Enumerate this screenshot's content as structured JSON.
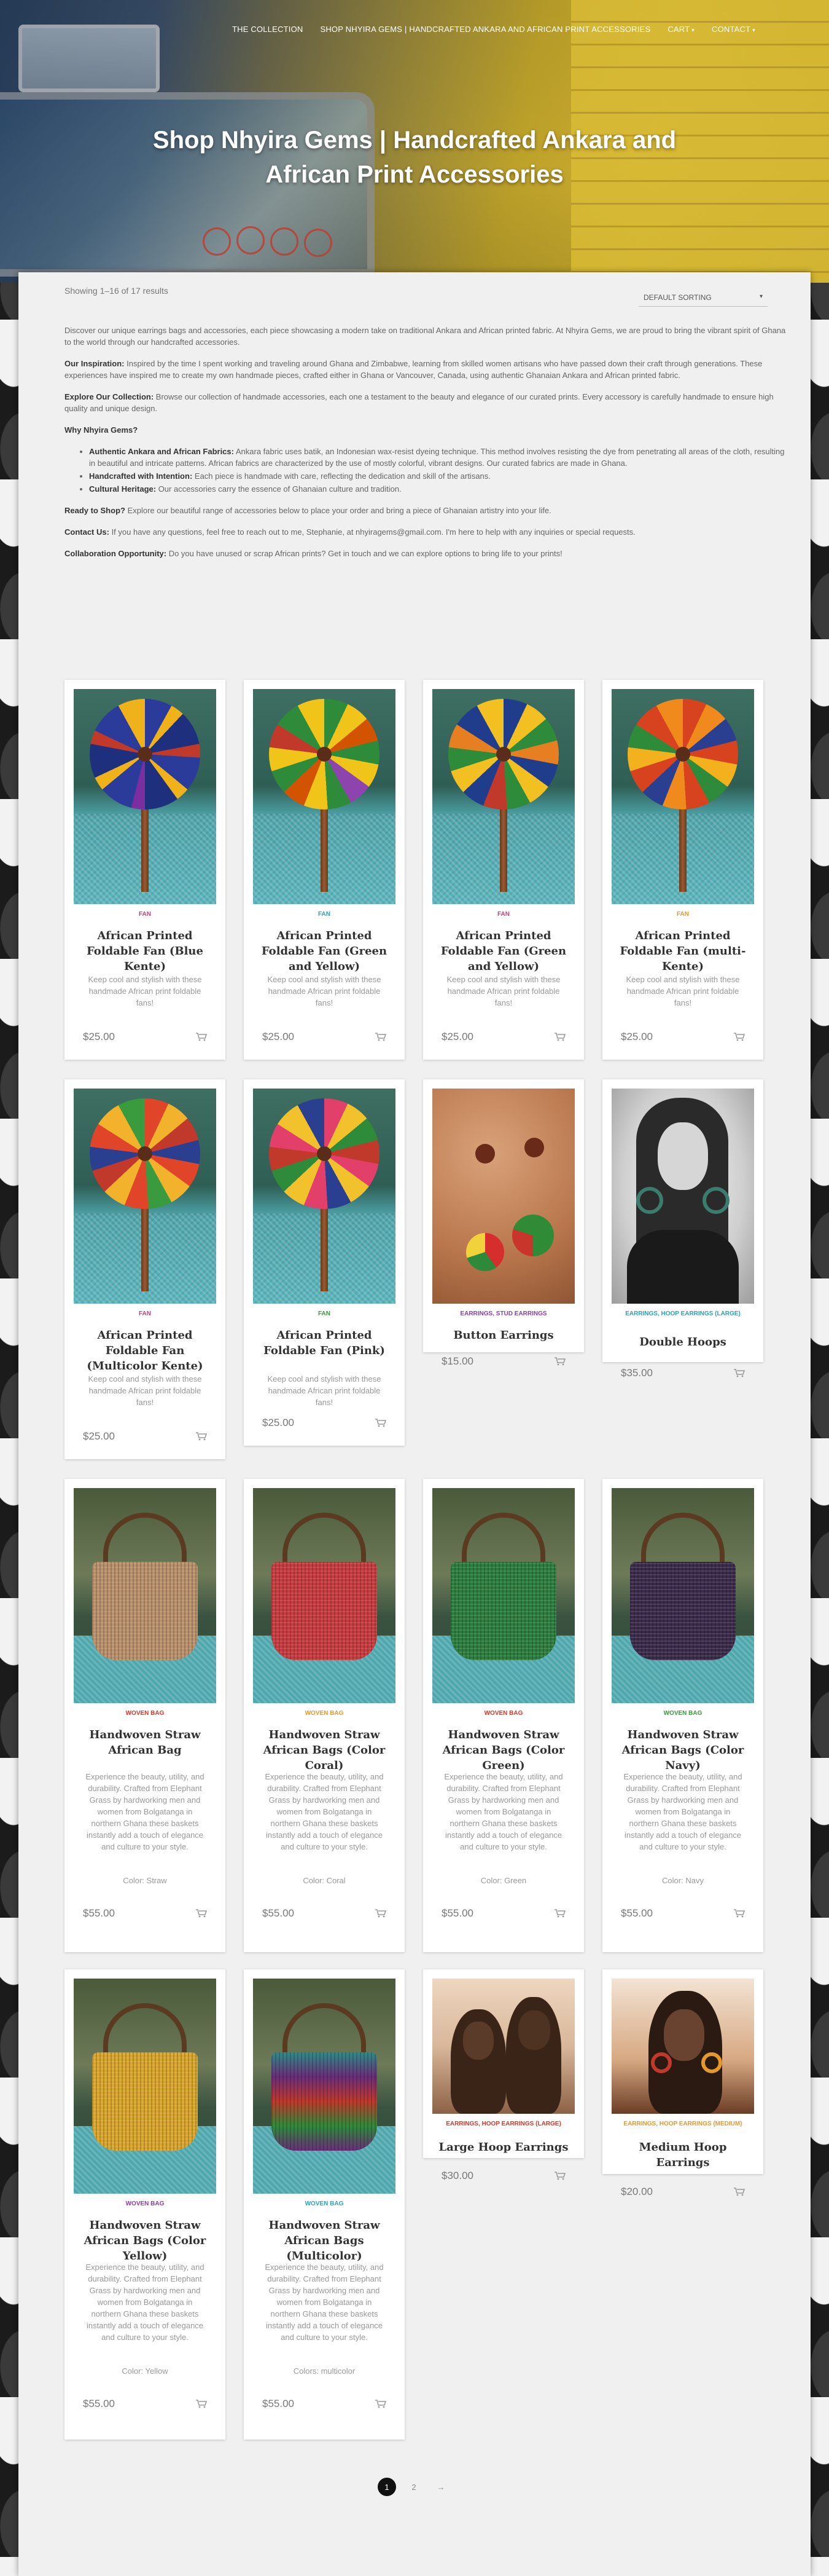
{
  "nav": {
    "items": [
      {
        "label": "THE COLLECTION"
      },
      {
        "label": "SHOP NHYIRA GEMS | HANDCRAFTED ANKARA AND AFRICAN PRINT ACCESSORIES"
      },
      {
        "label": "CART"
      },
      {
        "label": "CONTACT"
      }
    ]
  },
  "hero": {
    "title_line1": "Shop Nhyira Gems | Handcrafted Ankara and",
    "title_line2": "African Print Accessories"
  },
  "shop": {
    "result_count": "Showing 1–16 of 17 results",
    "ordering": "DEFAULT SORTING"
  },
  "description": {
    "intro": "Discover our unique earrings bags and accessories, each piece showcasing a modern take on traditional Ankara and African printed fabric. At Nhyira Gems, we are proud to bring the vibrant spirit of Ghana to the world through our handcrafted accessories.",
    "inspiration_label": "Our Inspiration:",
    "inspiration_text": " Inspired by the time I spent working and traveling around Ghana and Zimbabwe, learning from skilled women artisans who have passed down their craft through generations. These experiences have inspired me to create my own handmade pieces, crafted either in Ghana or Vancouver, Canada, using authentic Ghanaian Ankara and African printed fabric.",
    "collection_label": "Explore Our Collection:",
    "collection_text": " Browse our collection of handmade accessories, each one a testament to the beauty and elegance of our curated prints. Every accessory is carefully handmade to ensure high quality and unique design.",
    "why_label": "Why Nhyira Gems?",
    "bullets": [
      {
        "label": "Authentic Ankara and African Fabrics:",
        "text": " Ankara fabric uses batik, an Indonesian wax-resist dyeing technique. This method involves resisting the dye from penetrating all areas of the cloth, resulting in beautiful and intricate patterns. African fabrics are characterized by the use of mostly colorful, vibrant designs. Our curated fabrics are made in Ghana."
      },
      {
        "label": "Handcrafted with Intention:",
        "text": " Each piece is handmade with care, reflecting the dedication and skill of the artisans."
      },
      {
        "label": "Cultural Heritage:",
        "text": " Our accessories carry the essence of Ghanaian culture and tradition."
      }
    ],
    "ready_label": "Ready to Shop?",
    "ready_text": " Explore our beautiful range of accessories below to place your order and bring a piece of Ghanaian artistry into your life.",
    "contact_label": "Contact Us:",
    "contact_text": " If you have any questions, feel free to reach out to me, Stephanie, at nhyiragems@gmail.com. I'm here to help with any inquiries or special requests.",
    "collab_label": "Collaboration Opportunity:",
    "collab_text": " Do you have unused or scrap African prints? Get in touch and we can explore options to bring life to your prints!"
  },
  "products": [
    {
      "category": "FAN",
      "name": "African Printed Foldable Fan (Blue Kente)",
      "desc": "Keep cool and stylish with these handmade African print foldable fans!",
      "price": "$25.00",
      "cat_color": "#c2417f"
    },
    {
      "category": "FAN",
      "name": "African Printed Foldable Fan (Green and Yellow)",
      "desc": "Keep cool and stylish with these handmade African print foldable fans!",
      "price": "$25.00",
      "cat_color": "#2aa3b9"
    },
    {
      "category": "FAN",
      "name": "African Printed Foldable Fan (Green and Yellow)",
      "desc": "Keep cool and stylish with these handmade African print foldable fans!",
      "price": "$25.00",
      "cat_color": "#c2417f"
    },
    {
      "category": "FAN",
      "name": "African Printed Foldable Fan (multi-Kente)",
      "desc": "Keep cool and stylish with these handmade African print foldable fans!",
      "price": "$25.00",
      "cat_color": "#e39a2b"
    },
    {
      "category": "FAN",
      "name": "African Printed Foldable Fan (Multicolor Kente)",
      "desc": "Keep cool and stylish with these handmade African print foldable fans!",
      "price": "$25.00",
      "cat_color": "#c2417f"
    },
    {
      "category": "FAN",
      "name": "African Printed Foldable Fan (Pink)",
      "desc": "Keep cool and stylish with these handmade African print foldable fans!",
      "price": "$25.00",
      "cat_color": "#3a9a3e"
    },
    {
      "category": "EARRINGS, STUD EARRINGS",
      "name": "Button Earrings",
      "desc": "",
      "price": "$15.00",
      "cat_color": "#8a3fa8"
    },
    {
      "category": "EARRINGS, HOOP EARRINGS (LARGE)",
      "name": "Double Hoops",
      "desc": "",
      "price": "$35.00",
      "cat_color": "#2aa3b9"
    },
    {
      "category": "WOVEN BAG",
      "name": "Handwoven Straw African Bag",
      "desc": "Experience the beauty, utility, and durability. Crafted from Elephant Grass by hardworking men and women from Bolgatanga in northern Ghana these baskets instantly add a touch of elegance and culture to your style.",
      "color": "Color: Straw",
      "price": "$55.00",
      "cat_color": "#d33a2c"
    },
    {
      "category": "WOVEN BAG",
      "name": "Handwoven Straw African Bags (Color Coral)",
      "desc": "Experience the beauty, utility, and durability. Crafted from Elephant Grass by hardworking men and women from Bolgatanga in northern Ghana these baskets instantly add a touch of elegance and culture to your style.",
      "color": "Color: Coral",
      "price": "$55.00",
      "cat_color": "#e39a2b"
    },
    {
      "category": "WOVEN BAG",
      "name": "Handwoven Straw African Bags (Color Green)",
      "desc": "Experience the beauty, utility, and durability. Crafted from Elephant Grass by hardworking men and women from Bolgatanga in northern Ghana these baskets instantly add a touch of elegance and culture to your style.",
      "color": "Color: Green",
      "price": "$55.00",
      "cat_color": "#d33a2c"
    },
    {
      "category": "WOVEN BAG",
      "name": "Handwoven Straw African Bags (Color Navy)",
      "desc": "Experience the beauty, utility, and durability. Crafted from Elephant Grass by hardworking men and women from Bolgatanga in northern Ghana these baskets instantly add a touch of elegance and culture to your style.",
      "color": "Color: Navy",
      "price": "$55.00",
      "cat_color": "#3a9a3e"
    },
    {
      "category": "WOVEN BAG",
      "name": "Handwoven Straw African Bags (Color Yellow)",
      "desc": "Experience the beauty, utility, and durability. Crafted from Elephant Grass by hardworking men and women from Bolgatanga in northern Ghana these baskets instantly add a touch of elegance and culture to your style.",
      "color": "Color: Yellow",
      "price": "$55.00",
      "cat_color": "#8a3fa8"
    },
    {
      "category": "WOVEN BAG",
      "name": "Handwoven Straw African Bags (Multicolor)",
      "desc": "Experience the beauty, utility, and durability. Crafted from Elephant Grass by hardworking men and women from Bolgatanga in northern Ghana these baskets instantly add a touch of elegance and culture to your style.",
      "color": "Colors: multicolor",
      "price": "$55.00",
      "cat_color": "#2aa3b9"
    },
    {
      "category": "EARRINGS, HOOP EARRINGS (LARGE)",
      "name": "Large Hoop Earrings",
      "desc": "",
      "price": "$30.00",
      "cat_color": "#d33a2c"
    },
    {
      "category": "EARRINGS, HOOP EARRINGS (MEDIUM)",
      "name": "Medium Hoop Earrings",
      "desc": "",
      "price": "$20.00",
      "cat_color": "#e39a2b"
    }
  ],
  "pagination": {
    "pages": [
      "1",
      "2"
    ],
    "next": "→",
    "current": "1"
  }
}
